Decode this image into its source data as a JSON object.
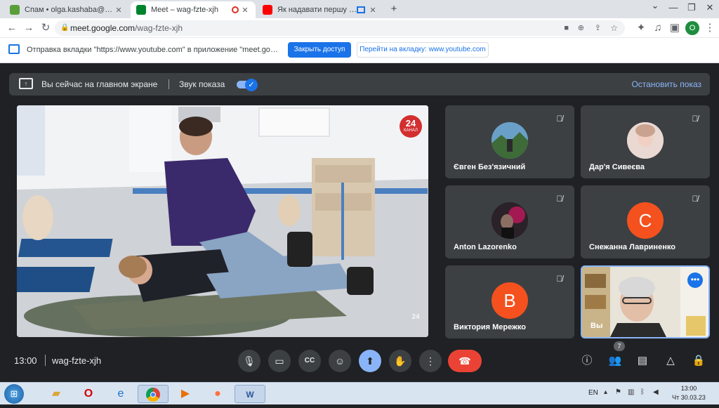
{
  "browser": {
    "tabs": [
      {
        "title": "Спам • olga.kashaba@ukr.net",
        "active": false,
        "favicon_color": "#5a9e3a"
      },
      {
        "title": "Meet – wag-fzte-xjh",
        "active": true,
        "favicon_color": "#00832d"
      },
      {
        "title": "",
        "active": false,
        "favicon_color": "#d93025"
      },
      {
        "title": "Як надавати першу домедич",
        "active": false,
        "favicon_color": "#ff0000"
      }
    ],
    "new_tab": "+",
    "url_host": "meet.google.com",
    "url_path": "/wag-fzte-xjh",
    "profile_initial": "O"
  },
  "infobar": {
    "message": "Отправка вкладки \"https://www.youtube.com\" в приложение \"meet.google.com\"...",
    "share_button": "Закрыть доступ",
    "switch_button": "Перейти на вкладку: www.youtube.com"
  },
  "present_bar": {
    "main_screen_text": "Вы сейчас на главном экране",
    "audio_label": "Звук показа",
    "audio_on": true,
    "stop_label": "Остановить показ"
  },
  "main_video": {
    "channel_badge": "24",
    "channel_sub": "КАНАЛ"
  },
  "participants": [
    {
      "name": "Євген Без'язичний",
      "avatar": "photo",
      "muted": true
    },
    {
      "name": "Дар'я Сивеєва",
      "avatar": "photo",
      "muted": true
    },
    {
      "name": "Anton Lazorenko",
      "avatar": "photo",
      "muted": true
    },
    {
      "name": "Снежанна Лавриненко",
      "avatar": "letter",
      "letter": "С",
      "color": "#f4511e",
      "muted": true
    },
    {
      "name": "Виктория Мережко",
      "avatar": "letter",
      "letter": "В",
      "color": "#f4511e",
      "muted": true
    },
    {
      "name": "Вы",
      "avatar": "video",
      "muted": false
    }
  ],
  "controls": {
    "time": "13:00",
    "meeting_code": "wag-fzte-xjh",
    "people_count": "7"
  },
  "taskbar": {
    "lang": "EN",
    "time": "13:00",
    "date": "Чт 30.03.23"
  }
}
